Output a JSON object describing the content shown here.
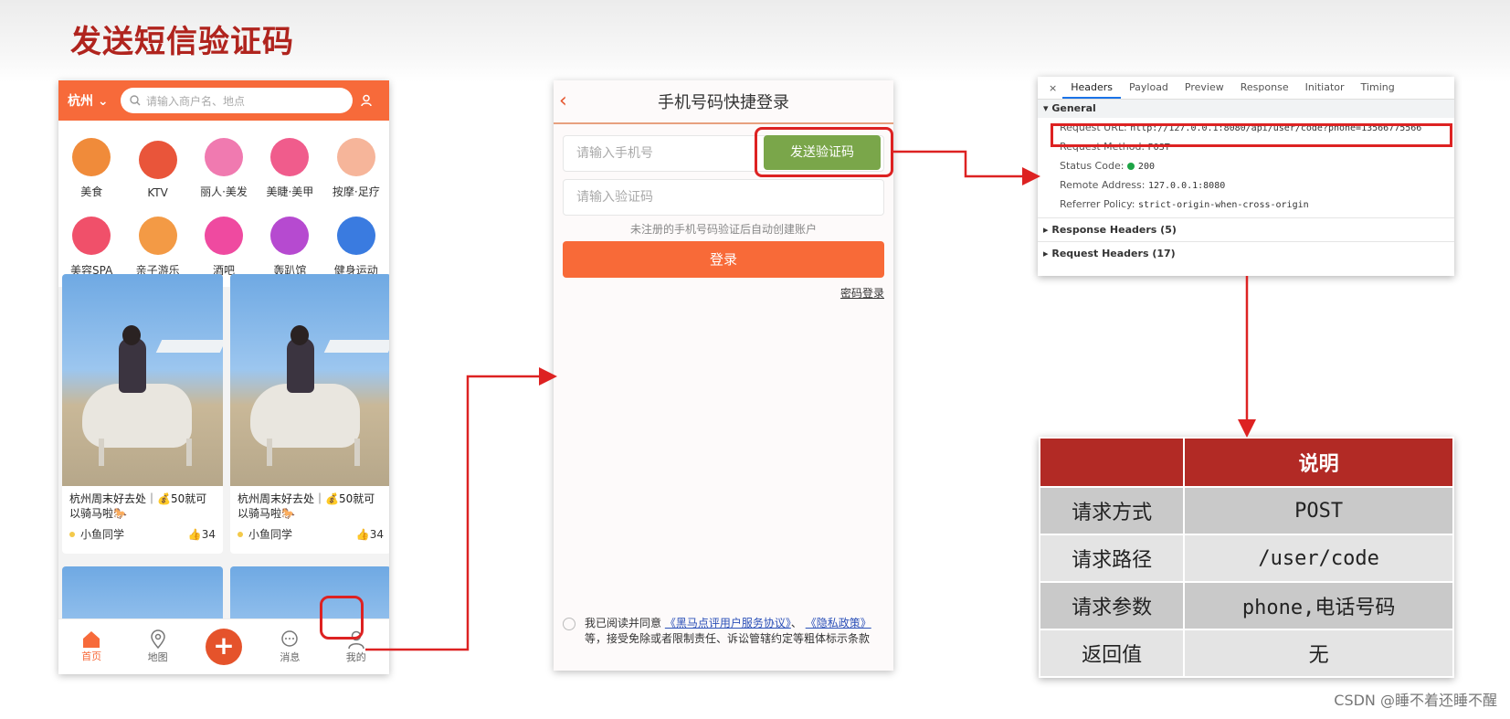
{
  "slide_title": "发送短信验证码",
  "phone1": {
    "city": "杭州",
    "search_placeholder": "请输入商户名、地点",
    "categories": [
      {
        "label": "美食",
        "icon": "food-icon",
        "color": "#f08b3a"
      },
      {
        "label": "KTV",
        "icon": "microphone-icon",
        "color": "#e9553a"
      },
      {
        "label": "丽人·美发",
        "icon": "hair-icon",
        "color": "#f07ab0"
      },
      {
        "label": "美睫·美甲",
        "icon": "nail-icon",
        "color": "#f05c8c"
      },
      {
        "label": "按摩·足疗",
        "icon": "foot-massage-icon",
        "color": "#f6b59a"
      },
      {
        "label": "美容SPA",
        "icon": "face-mask-icon",
        "color": "#f0506a"
      },
      {
        "label": "亲子游乐",
        "icon": "family-icon",
        "color": "#f39a45"
      },
      {
        "label": "酒吧",
        "icon": "cocktail-icon",
        "color": "#ef4aa0"
      },
      {
        "label": "轰趴馆",
        "icon": "party-mask-icon",
        "color": "#b64ad0"
      },
      {
        "label": "健身运动",
        "icon": "dumbbell-icon",
        "color": "#3a7be0"
      }
    ],
    "cards": [
      {
        "title": "杭州周末好去处｜💰50就可以骑马啦🐎",
        "author": "小鱼同学",
        "likes": "34"
      },
      {
        "title": "杭州周末好去处｜💰50就可以骑马啦🐎",
        "author": "小鱼同学",
        "likes": "34"
      }
    ],
    "nav": [
      {
        "label": "首页",
        "icon": "home-icon"
      },
      {
        "label": "地图",
        "icon": "map-pin-icon"
      },
      {
        "label": "+",
        "icon": "plus-icon"
      },
      {
        "label": "消息",
        "icon": "message-icon"
      },
      {
        "label": "我的",
        "icon": "user-icon"
      }
    ]
  },
  "phone2": {
    "title": "手机号码快捷登录",
    "phone_placeholder": "请输入手机号",
    "send_code": "发送验证码",
    "code_placeholder": "请输入验证码",
    "hint": "未注册的手机号码验证后自动创建账户",
    "login": "登录",
    "password_login": "密码登录",
    "agree_prefix": "我已阅读并同意",
    "agreement_link": "《黑马点评用户服务协议》",
    "comma": "、",
    "privacy_link": "《隐私政策》",
    "agree_suffix": "等，接受免除或者限制责任、诉讼管辖约定等粗体标示条款"
  },
  "devtools": {
    "tabs": [
      "Headers",
      "Payload",
      "Preview",
      "Response",
      "Initiator",
      "Timing"
    ],
    "general_label": "General",
    "rows": [
      {
        "key": "Request URL:",
        "value": "http://127.0.0.1:8080/api/user/code?phone=13566775566"
      },
      {
        "key": "Request Method:",
        "value": "POST"
      },
      {
        "key": "Status Code:",
        "value": "200"
      },
      {
        "key": "Remote Address:",
        "value": "127.0.0.1:8080"
      },
      {
        "key": "Referrer Policy:",
        "value": "strict-origin-when-cross-origin"
      }
    ],
    "response_headers": "Response Headers (5)",
    "request_headers": "Request Headers (17)"
  },
  "table": {
    "header": [
      "",
      "说明"
    ],
    "rows": [
      [
        "请求方式",
        "POST"
      ],
      [
        "请求路径",
        "/user/code"
      ],
      [
        "请求参数",
        "phone,电话号码"
      ],
      [
        "返回值",
        "无"
      ]
    ]
  },
  "watermark": "CSDN @睡不着还睡不醒",
  "colors": {
    "title": "#b0241e",
    "accent": "#f76a3a",
    "send_button": "#7aa64a",
    "highlight": "#dd2222",
    "table_header": "#b22a25"
  }
}
